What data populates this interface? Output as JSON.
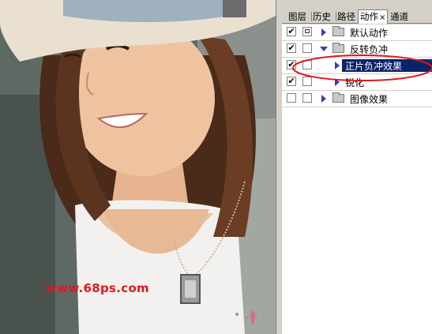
{
  "watermark": "www.68ps.com",
  "tabs": [
    {
      "label": "图层",
      "active": false
    },
    {
      "label": "历史",
      "active": false
    },
    {
      "label": "路径",
      "active": false
    },
    {
      "label": "动作",
      "active": true
    },
    {
      "label": "通道",
      "active": false
    }
  ],
  "tab_close": "×",
  "actions": {
    "set_default": {
      "label": "默认动作",
      "checked": true,
      "dialog": true
    },
    "set_invert": {
      "label": "反转负冲",
      "checked": true,
      "dialog": false,
      "expanded": true
    },
    "action_positive": {
      "label": "正片负冲效果",
      "checked": true,
      "dialog": false,
      "selected": true
    },
    "action_sharpen": {
      "label": "锐化",
      "checked": true,
      "dialog": false
    },
    "set_image": {
      "label": "图像效果",
      "checked": false,
      "dialog": false
    }
  },
  "check_mark": "✔",
  "colors": {
    "selection": "#0a246a",
    "annotation": "#e0181b",
    "panel": "#d4d0c8"
  }
}
